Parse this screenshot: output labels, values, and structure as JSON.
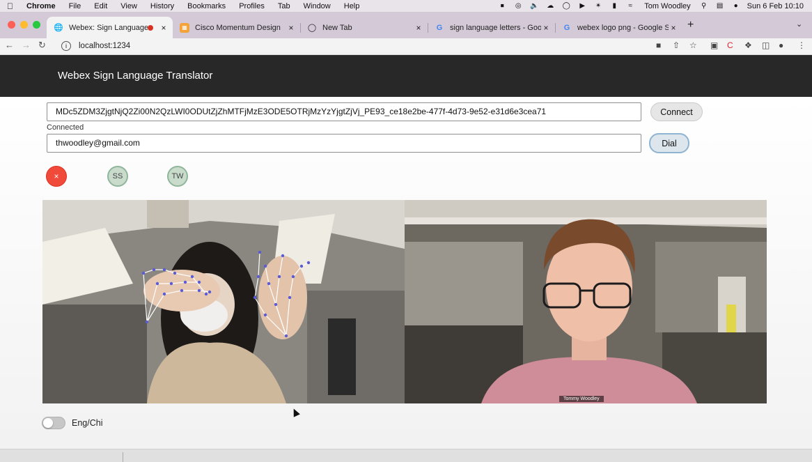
{
  "os_menu": {
    "app": "Chrome",
    "items": [
      "File",
      "Edit",
      "View",
      "History",
      "Bookmarks",
      "Profiles",
      "Tab",
      "Window",
      "Help"
    ],
    "user": "Tom Woodley",
    "clock": "Sun 6 Feb  10:10"
  },
  "tabs": [
    {
      "label": "Webex: Sign Language",
      "active": true,
      "recording": true
    },
    {
      "label": "Cisco Momentum Design"
    },
    {
      "label": "New Tab"
    },
    {
      "label": "sign language letters - Google"
    },
    {
      "label": "webex logo png - Google Sear"
    }
  ],
  "address": {
    "url": "localhost:1234"
  },
  "app": {
    "title": "Webex Sign Language Translator"
  },
  "connect": {
    "token": "MDc5ZDM3ZjgtNjQ2Zi00N2QzLWI0ODUtZjZhMTFjMzE3ODE5OTRjMzYzYjgtZjVj_PE93_ce18e2be-477f-4d73-9e52-e31d6e3cea71",
    "button": "Connect",
    "status": "Connected"
  },
  "dial": {
    "address": "thwoodley@gmail.com",
    "button": "Dial"
  },
  "participants": {
    "hangup_glyph": "×",
    "avatars": [
      "SS",
      "TW"
    ]
  },
  "remote_video": {
    "name_tag": "Tommy Woodley"
  },
  "language_toggle": {
    "label": "Eng/Chi",
    "on": false
  },
  "colors": {
    "header_bg": "#282828",
    "hangup": "#ef4a3a",
    "avatar_bg": "#c9dccc",
    "dial_border": "#8fb3d1",
    "landmarks": "#5b5bd6"
  }
}
